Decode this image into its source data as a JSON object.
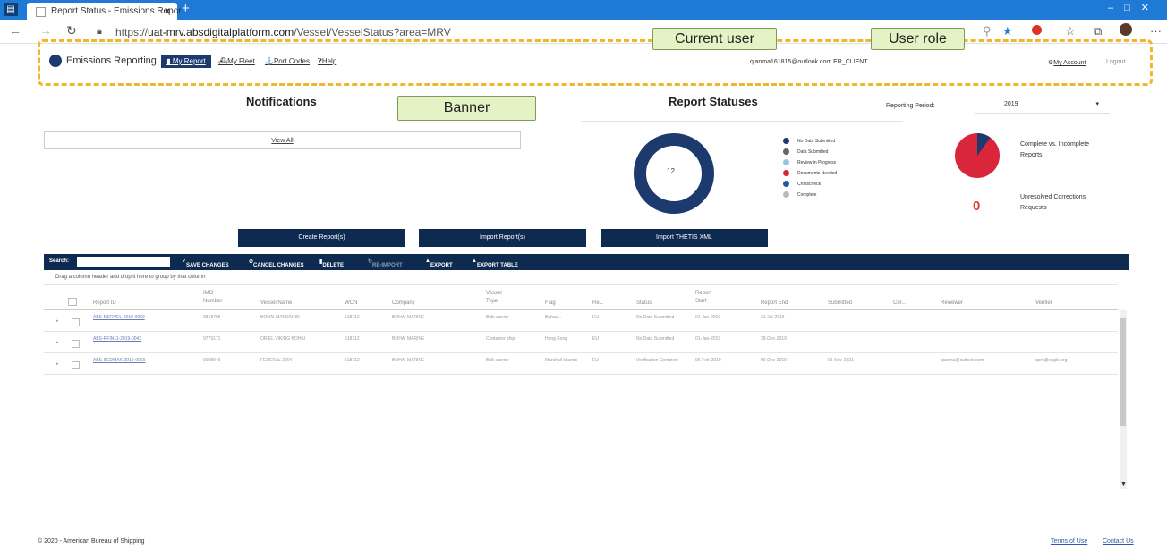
{
  "browser": {
    "tab_title": "Report Status - Emissions Repor",
    "tab_close": "x",
    "new_tab": "+",
    "url_prefix": "https://",
    "url_host": "uat-mrv.absdigitalplatform.com",
    "url_path": "/Vessel/VesselStatus?area=MRV"
  },
  "header": {
    "brand": "Emissions Reporting",
    "nav": {
      "my_report": "My Report",
      "my_fleet": "My Fleet",
      "port_codes": "Port Codes",
      "help": "Help"
    },
    "user_email": "qianma161815@outlook.com",
    "user_role": "ER_CLIENT",
    "my_account": "My Account",
    "logout": "Logout"
  },
  "callouts": {
    "current_user": "Current user",
    "user_role": "User role",
    "banner": "Banner"
  },
  "notifications": {
    "title": "Notifications",
    "view_all": "View All"
  },
  "report_statuses": {
    "title": "Report Statuses",
    "period_label": "Reporting Period:",
    "period_value": "2019",
    "donut_total": "12",
    "legend": [
      {
        "label": "No Data Submitted",
        "color": "#1c3a6e"
      },
      {
        "label": "Data Submitted",
        "color": "#666666"
      },
      {
        "label": "Review in Progress",
        "color": "#9ac1e8"
      },
      {
        "label": "Documents Needed",
        "color": "#d9263b"
      },
      {
        "label": "Crosscheck",
        "color": "#1f5aa0"
      },
      {
        "label": "Complete",
        "color": "#bbbbbb"
      }
    ],
    "complete_label": "Complete vs. Incomplete Reports",
    "complete_fraction": 0.1,
    "unresolved_label": "Unresolved Corrections Requests",
    "unresolved_count": "0"
  },
  "buttons": {
    "create": "Create Report(s)",
    "import": "Import Report(s)",
    "import_thetis": "Import THETIS XML"
  },
  "grid": {
    "search_label": "Search:",
    "toolbar": {
      "save": "SAVE CHANGES",
      "cancel": "CANCEL CHANGES",
      "delete": "DELETE",
      "reimport": "RE-IMPORT",
      "export": "EXPORT",
      "export_table": "EXPORT TABLE"
    },
    "group_hint": "Drag a column header and drop it here to group by that column",
    "columns": {
      "report_id": "Report ID",
      "imo": "IMO Number",
      "vessel": "Vessel Name",
      "wcn": "WCN",
      "company": "Company",
      "vessel_type": "Vessel Type",
      "flag": "Flag",
      "re": "Re...",
      "status": "Status",
      "report_start": "Report Start",
      "report_end": "Report End",
      "submitted": "Submitted",
      "cor": "Cor...",
      "reviewer": "Reviewer",
      "verifier": "Verifier"
    },
    "rows": [
      {
        "id": "ABS-MERVEL-2019-0050",
        "imo": "9818705",
        "vessel": "BOHAI MANDARIN",
        "wcn": "518712",
        "company": "BOHAI MARINE",
        "type": "Bulk carrier",
        "flag": "Bahas...",
        "re": "EU",
        "status": "No Data Submitted",
        "start": "01-Jan-2019",
        "end": "31-Jul-2019",
        "submitted": "",
        "reviewer": "",
        "verifier": ""
      },
      {
        "id": "ABS-RFIN11-2019-0043",
        "imo": "9779171",
        "vessel": "ORIEL VIKING BOHAI",
        "wcn": "518712",
        "company": "BOHAI MARINE",
        "type": "Container ship",
        "flag": "Hong Kong",
        "re": "EU",
        "status": "No Data Submitted",
        "start": "01-Jan-2019",
        "end": "28-Dec-2019",
        "submitted": "",
        "reviewer": "",
        "verifier": ""
      },
      {
        "id": "ABS-SEDMAK-2019-0050",
        "imo": "9028946",
        "vessel": "FEDERAL 2004",
        "wcn": "518712",
        "company": "BOHAI MARINE",
        "type": "Bulk carrier",
        "flag": "Marshall Islands",
        "re": "EU",
        "status": "Verification Complete",
        "start": "06-Feb-2019",
        "end": "09-Dec-2019",
        "submitted": "01-Nov-2021",
        "reviewer": "qianma@outlook.com",
        "verifier": "qxm@eagle.org"
      }
    ]
  },
  "footer": {
    "copyright": "© 2020 - American Bureau of Shipping",
    "terms": "Terms of Use",
    "contact": "Contact Us"
  }
}
